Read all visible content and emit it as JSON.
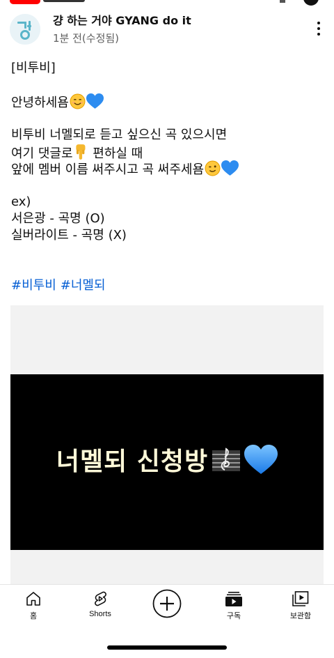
{
  "post": {
    "channel_name": "걍 하는 거야 GYANG do it",
    "time": "1분 전(수정됨)",
    "lines": {
      "l1": "[비투비]",
      "l2": "안녕하세욤",
      "l3": "비투비 너멜되로 듣고 싶으신 곡 있으시면",
      "l4": "여기 댓글로",
      "l4b": "편하실 때",
      "l5": "앞에 멤버 이름 써주시고 곡 써주세욤",
      "l6": "ex)",
      "l7": "서은광 - 곡명 (O)",
      "l8": "실버라이트 - 곡명 (X)"
    },
    "hashtags": [
      "#비투비",
      "#너멜되"
    ]
  },
  "image": {
    "text": "너멜되 신청방"
  },
  "nav": {
    "home": "홈",
    "shorts": "Shorts",
    "subscriptions": "구독",
    "library": "보관함"
  },
  "icons": {
    "smile": "smiling-face-emoji",
    "heart": "blue-heart-emoji",
    "point": "pointing-down-emoji",
    "wink": "winking-face-emoji",
    "score": "musical-score-emoji"
  },
  "colors": {
    "hashtag": "#065fd4",
    "image_text": "#fff9d8",
    "heart": "#2d8cf0",
    "brand": "#ff0000"
  }
}
